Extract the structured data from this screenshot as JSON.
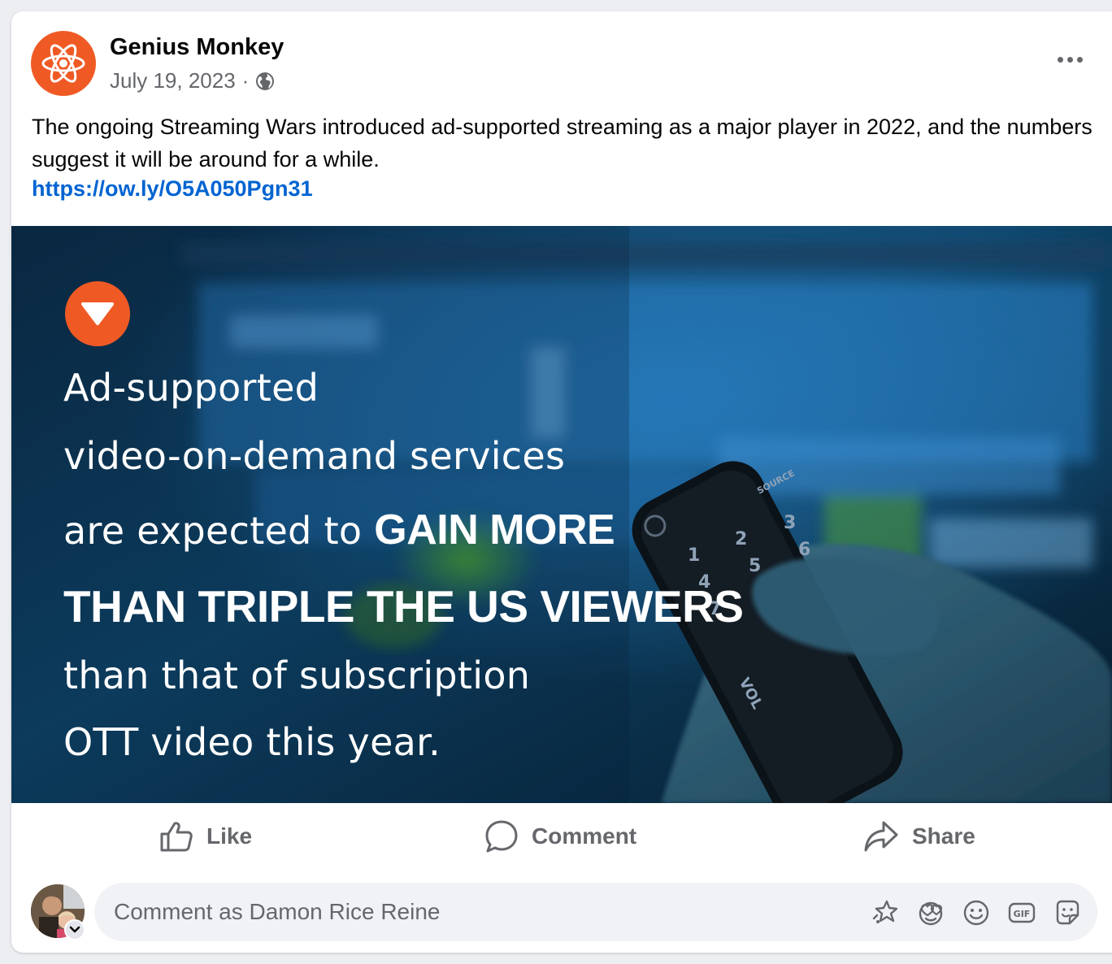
{
  "post": {
    "author": "Genius Monkey",
    "date": "July 19, 2023",
    "separator": "·",
    "text": "The ongoing Streaming Wars introduced ad-supported streaming as a major player in 2022, and the numbers suggest it will be around for a while.",
    "link": "https://ow.ly/O5A050Pgn31",
    "brand_color": "#ef5a24",
    "link_color": "#0064d1"
  },
  "image": {
    "line1": "Ad-supported",
    "line2": "video-on-demand services",
    "line3_regular": "are expected to",
    "line3_bold": "GAIN MORE",
    "line4": "THAN TRIPLE THE US VIEWERS",
    "line5": "than that of subscription",
    "line6": "OTT video this year.",
    "remote": {
      "source_label": "SOURCE",
      "keys": [
        "1",
        "2",
        "3",
        "4",
        "5",
        "6",
        "7"
      ],
      "vol_label": "VOL"
    }
  },
  "actions": {
    "like": "Like",
    "comment": "Comment",
    "share": "Share"
  },
  "comment_bar": {
    "placeholder": "Comment as Damon Rice Reine",
    "icons": [
      "avatar-sticker-icon",
      "emoji-heart-icon",
      "smiley-icon",
      "gif-icon",
      "sticker-icon"
    ]
  }
}
